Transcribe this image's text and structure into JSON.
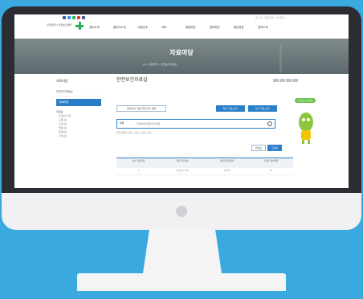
{
  "site": {
    "logo_text": "인천광역시 안전보건센터",
    "top_right": "로그인 | 회원가입 | 사이트맵",
    "menu": [
      "센터소개",
      "클리닉소개",
      "사업안내",
      "자료",
      "알림마당",
      "참여마당",
      "열린광장",
      "참여소개"
    ]
  },
  "banner": {
    "title": "자료마당",
    "breadcrumb": "홈 > 자료마당 > 안전보건자료실"
  },
  "sidebar": {
    "title": "자료마당",
    "items": [
      {
        "label": "안전보건자료실"
      },
      {
        "label": "자료마당"
      }
    ],
    "sub_title": "자료실",
    "sub_items": [
      "안전보건자료",
      "교육자료",
      "홍보자료",
      "법령자료",
      "통계자료",
      "기타자료"
    ]
  },
  "content": {
    "page_title": "안전보건자료실",
    "filter_btn": "안전보건 자료 카테고리 선택",
    "blue_btn_1": "최근 자료 보기",
    "blue_btn_2": "인기 자료 보기",
    "search": {
      "select_label": "제목",
      "placeholder": "검색어를 입력해 주세요"
    },
    "tags_label": "인기검색어: 안전 / 보건 / 교육 / 건강",
    "bubble": "안전보건 자료실",
    "tbl_btn_1": "최신순",
    "tbl_btn_2": "조회순",
    "table": {
      "headers": [
        "번호 자료유형",
        "제목 자료정보",
        "작성자 등록일자",
        "조회수 첨부파일"
      ],
      "rows": [
        [
          "1",
          "안전보건 자료",
          "관리자",
          "12"
        ]
      ]
    }
  },
  "colors": {
    "accent": "#2a7fc9",
    "green": "#2bae5a",
    "page_bg": "#3aa9e0"
  }
}
